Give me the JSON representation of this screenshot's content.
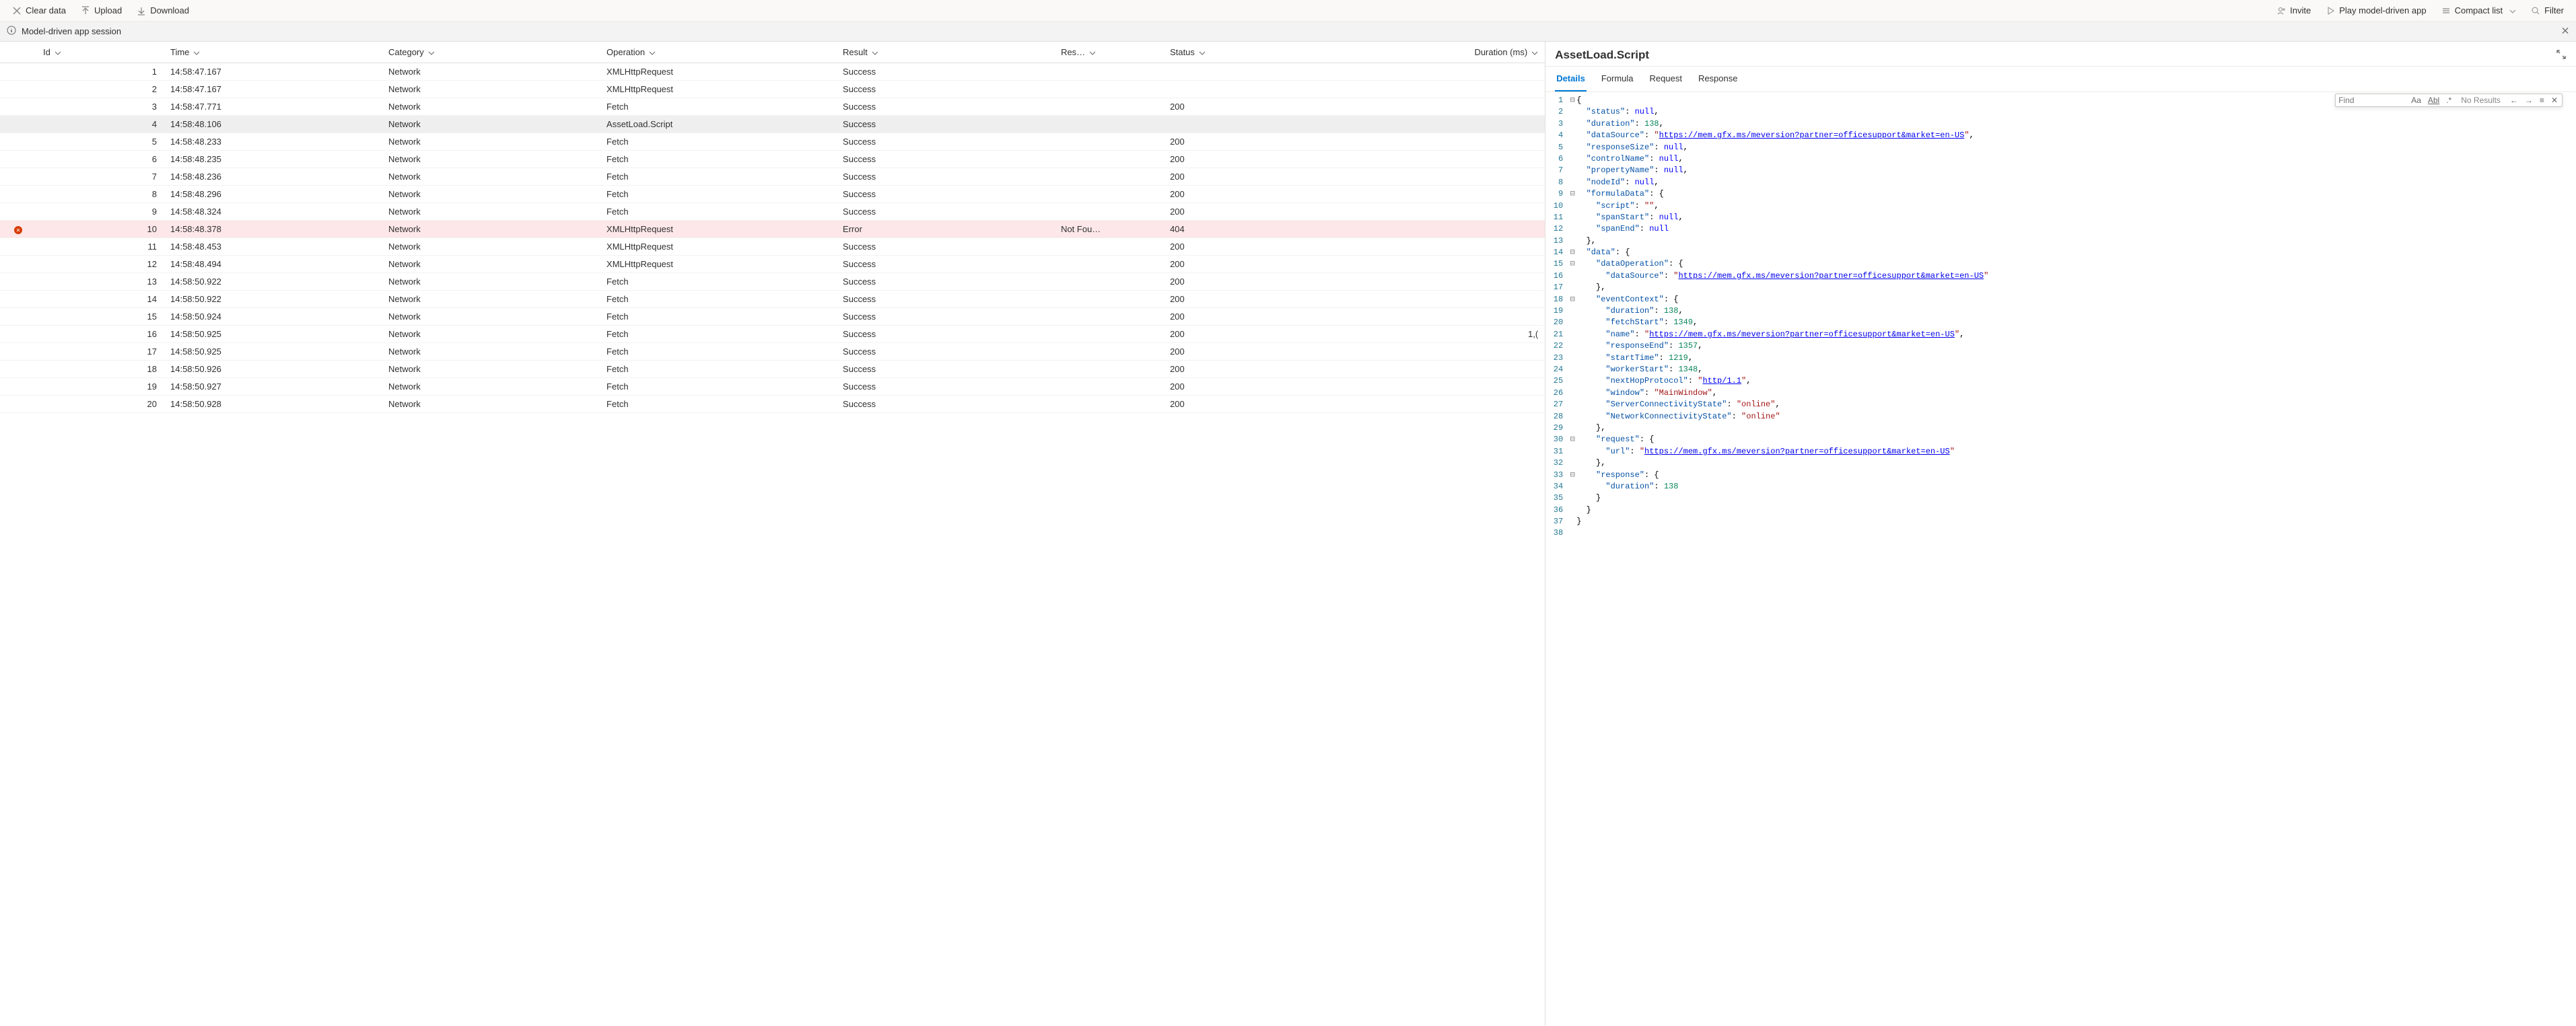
{
  "toolbar": {
    "left": {
      "clear": "Clear data",
      "upload": "Upload",
      "download": "Download"
    },
    "right": {
      "invite": "Invite",
      "play": "Play model-driven app",
      "compact": "Compact list",
      "filter": "Filter"
    }
  },
  "infobar": {
    "text": "Model-driven app session"
  },
  "table": {
    "columns": {
      "id": "Id",
      "time": "Time",
      "category": "Category",
      "operation": "Operation",
      "result": "Result",
      "res2": "Res…",
      "status": "Status",
      "duration": "Duration (ms)"
    },
    "rows": [
      {
        "id": "1",
        "time": "14:58:47.167",
        "cat": "Network",
        "op": "XMLHttpRequest",
        "res": "Success",
        "res2": "",
        "status": "",
        "dur": "",
        "sel": false,
        "err": false
      },
      {
        "id": "2",
        "time": "14:58:47.167",
        "cat": "Network",
        "op": "XMLHttpRequest",
        "res": "Success",
        "res2": "",
        "status": "",
        "dur": "",
        "sel": false,
        "err": false
      },
      {
        "id": "3",
        "time": "14:58:47.771",
        "cat": "Network",
        "op": "Fetch",
        "res": "Success",
        "res2": "",
        "status": "200",
        "dur": "",
        "sel": false,
        "err": false
      },
      {
        "id": "4",
        "time": "14:58:48.106",
        "cat": "Network",
        "op": "AssetLoad.Script",
        "res": "Success",
        "res2": "",
        "status": "",
        "dur": "",
        "sel": true,
        "err": false
      },
      {
        "id": "5",
        "time": "14:58:48.233",
        "cat": "Network",
        "op": "Fetch",
        "res": "Success",
        "res2": "",
        "status": "200",
        "dur": "",
        "sel": false,
        "err": false
      },
      {
        "id": "6",
        "time": "14:58:48.235",
        "cat": "Network",
        "op": "Fetch",
        "res": "Success",
        "res2": "",
        "status": "200",
        "dur": "",
        "sel": false,
        "err": false
      },
      {
        "id": "7",
        "time": "14:58:48.236",
        "cat": "Network",
        "op": "Fetch",
        "res": "Success",
        "res2": "",
        "status": "200",
        "dur": "",
        "sel": false,
        "err": false
      },
      {
        "id": "8",
        "time": "14:58:48.296",
        "cat": "Network",
        "op": "Fetch",
        "res": "Success",
        "res2": "",
        "status": "200",
        "dur": "",
        "sel": false,
        "err": false
      },
      {
        "id": "9",
        "time": "14:58:48.324",
        "cat": "Network",
        "op": "Fetch",
        "res": "Success",
        "res2": "",
        "status": "200",
        "dur": "",
        "sel": false,
        "err": false
      },
      {
        "id": "10",
        "time": "14:58:48.378",
        "cat": "Network",
        "op": "XMLHttpRequest",
        "res": "Error",
        "res2": "Not Fou…",
        "status": "404",
        "dur": "",
        "sel": false,
        "err": true
      },
      {
        "id": "11",
        "time": "14:58:48.453",
        "cat": "Network",
        "op": "XMLHttpRequest",
        "res": "Success",
        "res2": "",
        "status": "200",
        "dur": "",
        "sel": false,
        "err": false
      },
      {
        "id": "12",
        "time": "14:58:48.494",
        "cat": "Network",
        "op": "XMLHttpRequest",
        "res": "Success",
        "res2": "",
        "status": "200",
        "dur": "",
        "sel": false,
        "err": false
      },
      {
        "id": "13",
        "time": "14:58:50.922",
        "cat": "Network",
        "op": "Fetch",
        "res": "Success",
        "res2": "",
        "status": "200",
        "dur": "",
        "sel": false,
        "err": false
      },
      {
        "id": "14",
        "time": "14:58:50.922",
        "cat": "Network",
        "op": "Fetch",
        "res": "Success",
        "res2": "",
        "status": "200",
        "dur": "",
        "sel": false,
        "err": false
      },
      {
        "id": "15",
        "time": "14:58:50.924",
        "cat": "Network",
        "op": "Fetch",
        "res": "Success",
        "res2": "",
        "status": "200",
        "dur": "",
        "sel": false,
        "err": false
      },
      {
        "id": "16",
        "time": "14:58:50.925",
        "cat": "Network",
        "op": "Fetch",
        "res": "Success",
        "res2": "",
        "status": "200",
        "dur": "1,(",
        "sel": false,
        "err": false
      },
      {
        "id": "17",
        "time": "14:58:50.925",
        "cat": "Network",
        "op": "Fetch",
        "res": "Success",
        "res2": "",
        "status": "200",
        "dur": "",
        "sel": false,
        "err": false
      },
      {
        "id": "18",
        "time": "14:58:50.926",
        "cat": "Network",
        "op": "Fetch",
        "res": "Success",
        "res2": "",
        "status": "200",
        "dur": "",
        "sel": false,
        "err": false
      },
      {
        "id": "19",
        "time": "14:58:50.927",
        "cat": "Network",
        "op": "Fetch",
        "res": "Success",
        "res2": "",
        "status": "200",
        "dur": "",
        "sel": false,
        "err": false
      },
      {
        "id": "20",
        "time": "14:58:50.928",
        "cat": "Network",
        "op": "Fetch",
        "res": "Success",
        "res2": "",
        "status": "200",
        "dur": "",
        "sel": false,
        "err": false
      }
    ]
  },
  "details": {
    "title": "AssetLoad.Script",
    "tabs": [
      "Details",
      "Formula",
      "Request",
      "Response"
    ],
    "activeTab": "Details",
    "find": {
      "placeholder": "Find",
      "status": "No Results"
    }
  },
  "json_view": {
    "url": "https://mem.gfx.ms/meversion?partner=officesupport&market=en-US",
    "obj": {
      "status": null,
      "duration": 138,
      "dataSource": "https://mem.gfx.ms/meversion?partner=officesupport&market=en-US",
      "responseSize": null,
      "controlName": null,
      "propertyName": null,
      "nodeId": null,
      "formulaData": {
        "script": "",
        "spanStart": null,
        "spanEnd": null
      },
      "data": {
        "dataOperation": {
          "dataSource": "https://mem.gfx.ms/meversion?partner=officesupport&market=en-US"
        },
        "eventContext": {
          "duration": 138,
          "fetchStart": 1349,
          "name": "https://mem.gfx.ms/meversion?partner=officesupport&market=en-US",
          "responseEnd": 1357,
          "startTime": 1219,
          "workerStart": 1348,
          "nextHopProtocol": "http/1.1",
          "window": "MainWindow",
          "ServerConnectivityState": "online",
          "NetworkConnectivityState": "online"
        },
        "request": {
          "url": "https://mem.gfx.ms/meversion?partner=officesupport&market=en-US"
        },
        "response": {
          "duration": 138
        }
      }
    }
  }
}
